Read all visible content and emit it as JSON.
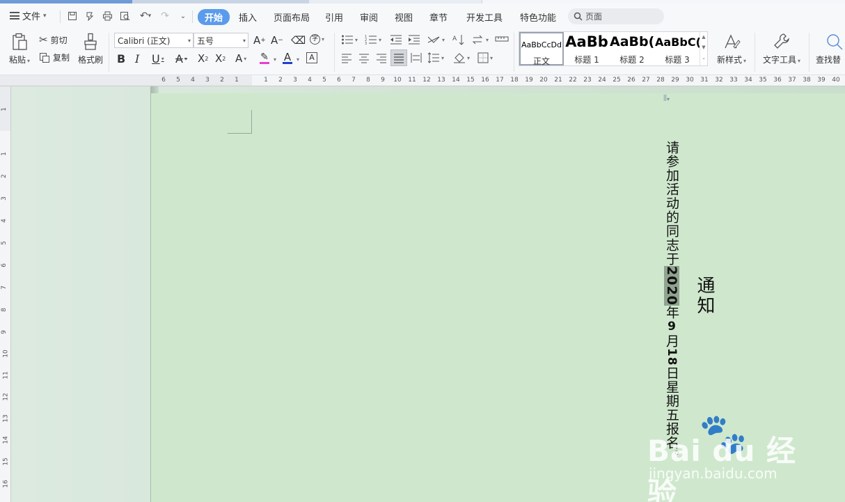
{
  "menu": {
    "file_label": "文件",
    "tabs": [
      "开始",
      "插入",
      "页面布局",
      "引用",
      "审阅",
      "视图",
      "章节",
      "开发工具",
      "特色功能"
    ],
    "search_placeholder": "页面"
  },
  "ribbon": {
    "paste": "粘贴",
    "cut": "剪切",
    "copy": "复制",
    "format_painter": "格式刷",
    "font_name": "Calibri (正文)",
    "font_size": "五号",
    "styles": [
      {
        "sample": "AaBbCcDd",
        "name": "正文"
      },
      {
        "sample": "AaBb",
        "name": "标题 1"
      },
      {
        "sample": "AaBb(",
        "name": "标题 2"
      },
      {
        "sample": "AaBbC(",
        "name": "标题 3"
      }
    ],
    "new_style": "新样式",
    "text_tools": "文字工具",
    "find_replace": "查找替"
  },
  "ruler": {
    "h_numbers_left": [
      "6",
      "5",
      "4",
      "3",
      "2",
      "1"
    ],
    "h_numbers_right": [
      "1",
      "2",
      "3",
      "4",
      "5",
      "6",
      "7",
      "8",
      "9",
      "10",
      "11",
      "12",
      "13",
      "14",
      "15",
      "16",
      "17",
      "18",
      "19",
      "20",
      "21",
      "22",
      "23",
      "24",
      "25",
      "26",
      "27",
      "28",
      "29",
      "30",
      "31",
      "32",
      "33",
      "34",
      "35",
      "36",
      "37",
      "38",
      "39",
      "40"
    ],
    "v_numbers": [
      "1",
      "",
      "1",
      "2",
      "3",
      "4",
      "5",
      "6",
      "7",
      "8",
      "9",
      "10",
      "11",
      "12",
      "13",
      "14",
      "15",
      "16"
    ]
  },
  "document": {
    "title": "通知",
    "body_part1": "请参加活动的同志于",
    "body_year": "2020",
    "body_part2": "年",
    "body_month": "9",
    "body_part3": "月",
    "body_day": "18",
    "body_part4": "日星期五报名。"
  },
  "watermark": {
    "brand": "Bai du 经验",
    "url": "jingyan.baidu.com"
  }
}
